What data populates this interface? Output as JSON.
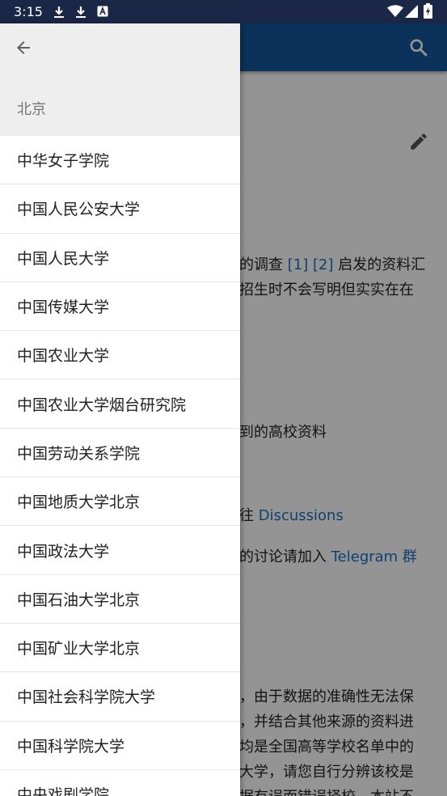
{
  "status_bar": {
    "time": "3:15",
    "icons": [
      "download-icon",
      "download-icon",
      "text-a-icon",
      "wifi-icon",
      "signal-icon",
      "battery-icon"
    ]
  },
  "background": {
    "app_bar_color": "#14569b",
    "lines": [
      {
        "text": "的调查 ",
        "links": [
          "[1]",
          "[2]"
        ],
        "after": " 启发的资料汇"
      },
      {
        "text": "招生时不会写明但实实在在"
      },
      {
        "text": "到的高校资料"
      },
      {
        "text": "往 ",
        "link": "Discussions"
      },
      {
        "text": "的讨论请加入 ",
        "link": "Telegram 群"
      },
      {
        "text": "，由于数据的准确性无法保"
      },
      {
        "text": "，并结合其他来源的资料进"
      },
      {
        "text": "均是全国高等学校名单中的"
      },
      {
        "text": "大学，请您自行分辨该校是"
      },
      {
        "text": "据有误而错误择校，本站不"
      }
    ]
  },
  "drawer": {
    "title": "北京",
    "items": [
      "中华女子学院",
      "中国人民公安大学",
      "中国人民大学",
      "中国传媒大学",
      "中国农业大学",
      "中国农业大学烟台研究院",
      "中国劳动关系学院",
      "中国地质大学北京",
      "中国政法大学",
      "中国石油大学北京",
      "中国矿业大学北京",
      "中国社会科学院大学",
      "中国科学院大学",
      "中央戏剧学院"
    ]
  }
}
